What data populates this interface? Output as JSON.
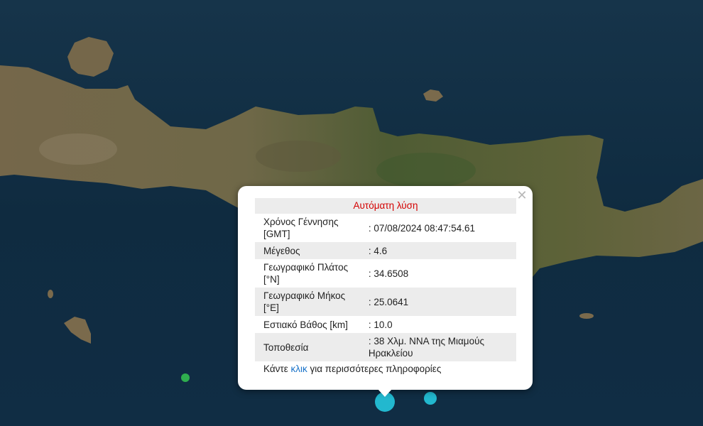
{
  "popup": {
    "title": "Αυτόματη λύση",
    "close_symbol": "✕",
    "rows": [
      {
        "label": "Χρόνος Γέννησης [GMT]",
        "value": ": 07/08/2024 08:47:54.61"
      },
      {
        "label": "Μέγεθος",
        "value": ": 4.6"
      },
      {
        "label": "Γεωγραφικό Πλάτος [°N]",
        "value": ": 34.6508"
      },
      {
        "label": "Γεωγραφικό Μήκος [°E]",
        "value": ": 25.0641"
      },
      {
        "label": "Εστιακό Βάθος [km]",
        "value": ": 10.0"
      },
      {
        "label": "Τοποθεσία",
        "value": ": 38 Χλμ. ΝΝΑ της Μιαμούς Ηρακλείου"
      }
    ],
    "footer_prefix": "Κάντε ",
    "footer_link": "κλικ",
    "footer_suffix": " για περισσότερες πληροφορίες"
  },
  "map": {
    "sea_color": "#0f2a3e",
    "land_color": "#6b6443",
    "marker_color": "#22b8cf",
    "minor_marker_color": "#2fae4f"
  }
}
